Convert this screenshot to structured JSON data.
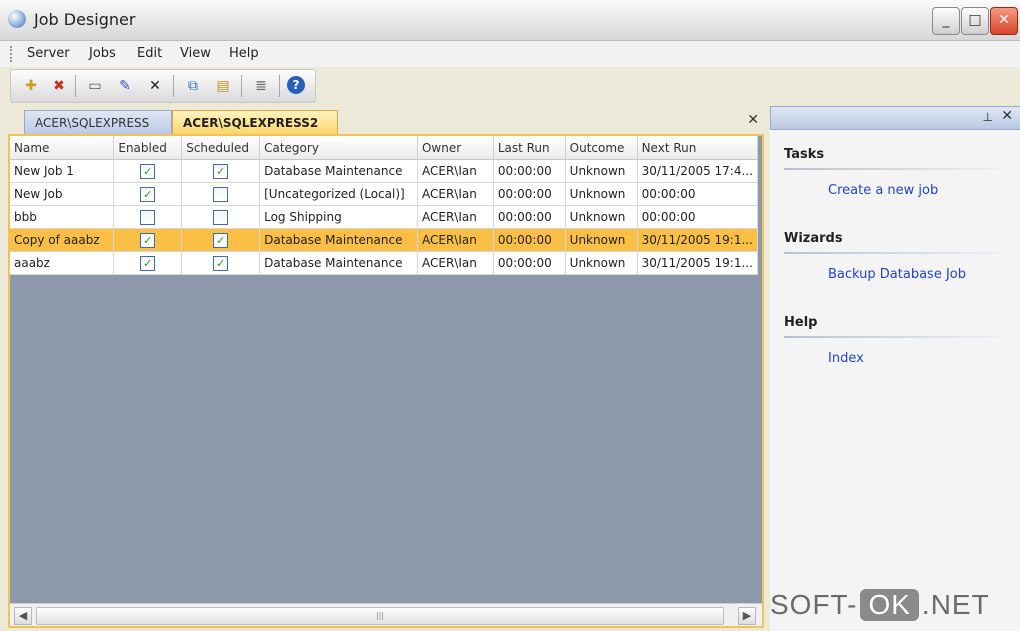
{
  "window": {
    "title": "Job Designer",
    "minimize": "_",
    "maximize": "□",
    "close": "✕"
  },
  "menu": [
    "Server",
    "Jobs",
    "Edit",
    "View",
    "Help"
  ],
  "toolbar": {
    "icons": [
      "new-job-icon",
      "delete-job-icon",
      "new-document-icon",
      "edit-icon",
      "cancel-icon",
      "copy-icon",
      "open-folder-icon",
      "properties-icon",
      "help-icon"
    ],
    "glyphs": [
      "✚",
      "✖",
      "▭",
      "✎",
      "✕",
      "⧉",
      "▤",
      "≣",
      "?"
    ]
  },
  "tabs": [
    {
      "label": "ACER\\SQLEXPRESS"
    },
    {
      "label": "ACER\\SQLEXPRESS2"
    }
  ],
  "tab_close": "✕",
  "grid": {
    "columns": [
      "Name",
      "Enabled",
      "Scheduled",
      "Category",
      "Owner",
      "Last Run",
      "Outcome",
      "Next Run"
    ],
    "rows": [
      {
        "name": "New Job 1",
        "enabled": true,
        "scheduled": true,
        "category": "Database Maintenance",
        "owner": "ACER\\Ian",
        "last_run": "00:00:00",
        "outcome": "Unknown",
        "next_run": "30/11/2005 17:4..."
      },
      {
        "name": "New Job",
        "enabled": true,
        "scheduled": false,
        "category": "[Uncategorized (Local)]",
        "owner": "ACER\\Ian",
        "last_run": "00:00:00",
        "outcome": "Unknown",
        "next_run": "00:00:00"
      },
      {
        "name": "bbb",
        "enabled": false,
        "scheduled": false,
        "category": "Log Shipping",
        "owner": "ACER\\Ian",
        "last_run": "00:00:00",
        "outcome": "Unknown",
        "next_run": "00:00:00"
      },
      {
        "name": "Copy of aaabz",
        "enabled": true,
        "scheduled": true,
        "category": "Database Maintenance",
        "owner": "ACER\\Ian",
        "last_run": "00:00:00",
        "outcome": "Unknown",
        "next_run": "30/11/2005 19:1...",
        "selected": true
      },
      {
        "name": "aaabz",
        "enabled": true,
        "scheduled": true,
        "category": "Database Maintenance",
        "owner": "ACER\\Ian",
        "last_run": "00:00:00",
        "outcome": "Unknown",
        "next_run": "30/11/2005 19:1..."
      }
    ],
    "check_glyph": "✓",
    "scroll_left": "◀",
    "scroll_right": "▶",
    "scroll_grip": "|||"
  },
  "side_panel": {
    "pin": "⊥",
    "close": "✕",
    "sections": [
      {
        "title": "Tasks",
        "link": "Create a new job"
      },
      {
        "title": "Wizards",
        "link": "Backup Database Job"
      },
      {
        "title": "Help",
        "link": "Index"
      }
    ]
  },
  "watermark": {
    "left": "SOFT-",
    "box": "OK",
    "right": ".NET"
  },
  "colors": {
    "selection": "#fbbf46",
    "grid_background": "#8e98ab",
    "link": "#2244cc"
  }
}
